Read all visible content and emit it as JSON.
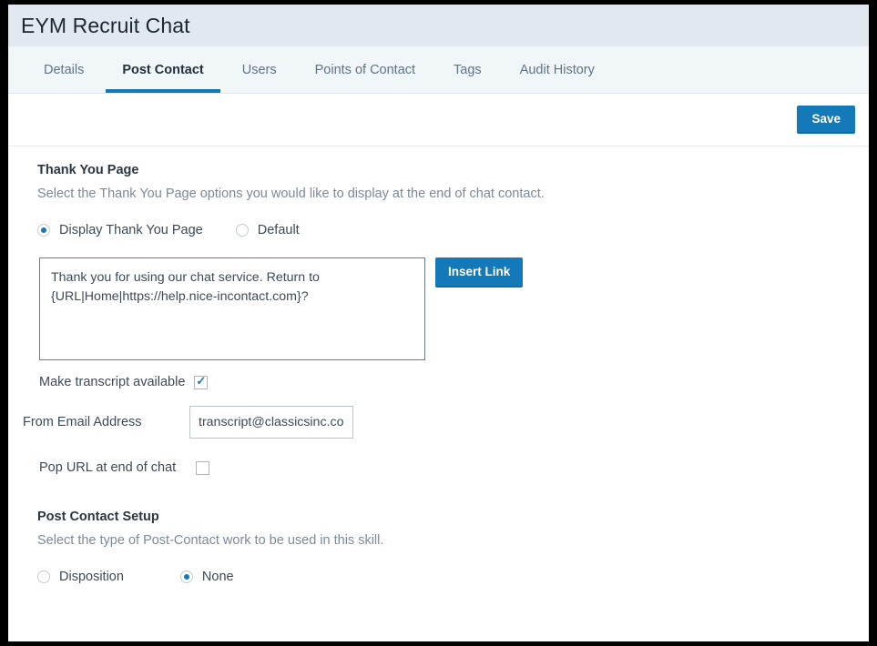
{
  "header": {
    "title": "EYM Recruit Chat"
  },
  "tabs": [
    {
      "label": "Details",
      "active": false
    },
    {
      "label": "Post Contact",
      "active": true
    },
    {
      "label": "Users",
      "active": false
    },
    {
      "label": "Points of Contact",
      "active": false
    },
    {
      "label": "Tags",
      "active": false
    },
    {
      "label": "Audit History",
      "active": false
    }
  ],
  "toolbar": {
    "save_label": "Save"
  },
  "thank_you_page": {
    "title": "Thank You Page",
    "description": "Select the Thank You Page options you would like to display at the end of chat contact.",
    "options": [
      {
        "label": "Display Thank You Page",
        "selected": true
      },
      {
        "label": "Default",
        "selected": false
      }
    ],
    "message_value": "Thank you for using our chat service. Return to {URL|Home|https://help.nice-incontact.com}?",
    "insert_link_label": "Insert Link",
    "transcript_label": "Make transcript available",
    "transcript_checked": true,
    "from_email_label": "From Email Address",
    "from_email_value": "transcript@classicsinc.com",
    "pop_url_label": "Pop URL at end of chat",
    "pop_url_checked": false
  },
  "post_contact_setup": {
    "title": "Post Contact Setup",
    "description": "Select the type of Post-Contact work to be used in this skill.",
    "options": [
      {
        "label": "Disposition",
        "selected": false
      },
      {
        "label": "None",
        "selected": true
      }
    ]
  },
  "colors": {
    "accent": "#1379b8",
    "header_bg": "#e2e8f0",
    "tabbar_bg": "#f1f6f9"
  }
}
